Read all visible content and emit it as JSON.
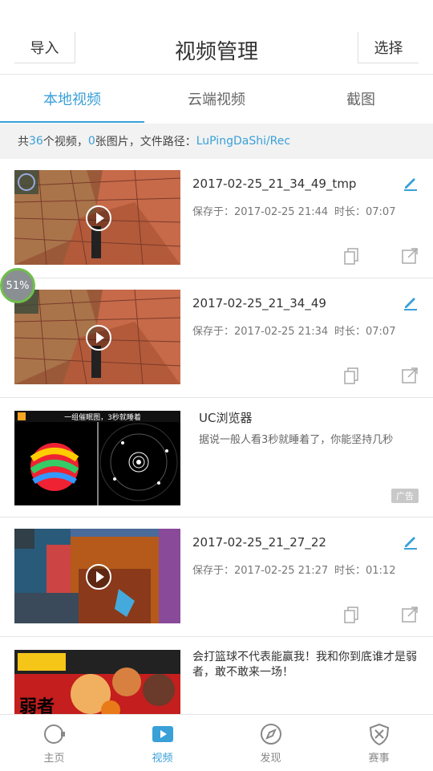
{
  "header": {
    "left_button": "导入",
    "title": "视频管理",
    "right_button": "选择"
  },
  "tabs": [
    {
      "label": "本地视频"
    },
    {
      "label": "云端视频"
    },
    {
      "label": "截图"
    }
  ],
  "info": {
    "prefix": "共 ",
    "video_count": "36",
    "mid1": " 个视频，",
    "image_count": "0",
    "mid2": " 张图片，文件路径：",
    "path": "LuPingDaShi/Rec"
  },
  "videos": [
    {
      "name": "2017-02-25_21_34_49_tmp",
      "saved": "保存于：2017-02-25 21:44",
      "duration": "时长：07:07"
    },
    {
      "name": "2017-02-25_21_34_49",
      "saved": "保存于：2017-02-25 21:34",
      "duration": "时长：07:07"
    },
    {
      "name": "2017-02-25_21_27_22",
      "saved": "保存于：2017-02-25 21:27",
      "duration": "时长：01:12"
    }
  ],
  "ads": [
    {
      "title": "UC浏览器",
      "desc": "据说一般人看3秒就睡着了，你能坚持几秒",
      "badge": "广告",
      "banner_text": "一组催眠图，3秒就睡着"
    },
    {
      "desc": "会打篮球不代表能赢我！我和你到底谁才是弱者，敢不敢来一场！",
      "banner_text": "弱者"
    }
  ],
  "progress_badge": "51%",
  "bottom_nav": [
    {
      "label": "主页"
    },
    {
      "label": "视频"
    },
    {
      "label": "发现"
    },
    {
      "label": "赛事"
    }
  ],
  "colors": {
    "accent": "#3aa0d8",
    "text": "#333333",
    "muted": "#777777"
  }
}
